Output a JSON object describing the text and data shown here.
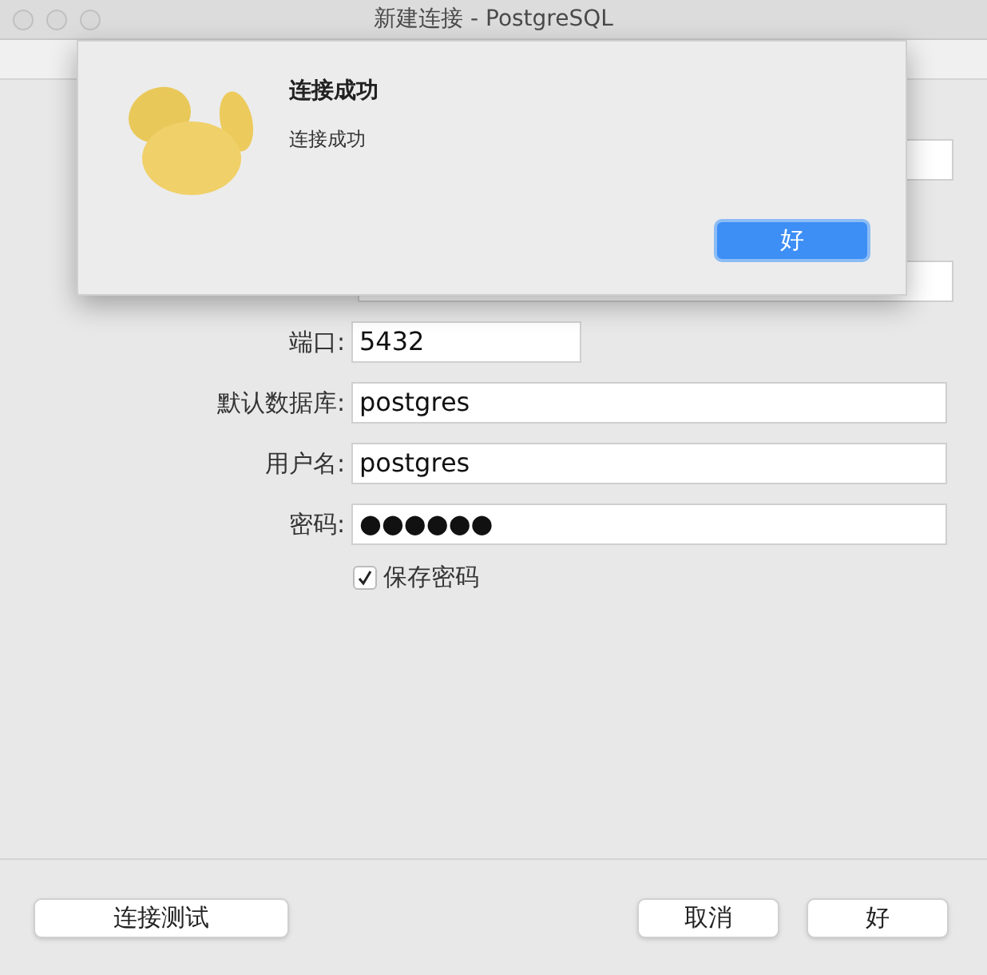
{
  "window": {
    "title": "新建连接 - PostgreSQL"
  },
  "form": {
    "fields": [
      {
        "label": "端口:",
        "value": "5432",
        "kind": "short"
      },
      {
        "label": "默认数据库:",
        "value": "postgres",
        "kind": "wide"
      },
      {
        "label": "用户名:",
        "value": "postgres",
        "kind": "wide"
      },
      {
        "label": "密码:",
        "value": "●●●●●●",
        "kind": "wide"
      }
    ],
    "save_password": {
      "label": "保存密码",
      "checked": true
    }
  },
  "alert": {
    "title": "连接成功",
    "message": "连接成功",
    "button": "好"
  },
  "footer": {
    "test_button": "连接测试",
    "buttons": [
      "取消",
      "好"
    ]
  }
}
